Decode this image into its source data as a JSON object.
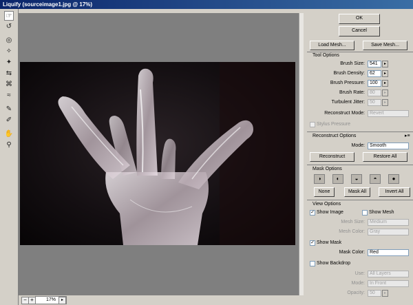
{
  "window": {
    "title": "Liquify (sourceimage1.jpg @ 17%)"
  },
  "tools": [
    {
      "icon": "forward-warp-icon",
      "glyph": "☞"
    },
    {
      "icon": "reconstruct-tool-icon",
      "glyph": "↺"
    },
    {
      "icon": "twirl-clockwise-icon",
      "glyph": "◎"
    },
    {
      "icon": "pucker-icon",
      "glyph": "✧"
    },
    {
      "icon": "bloat-icon",
      "glyph": "✦"
    },
    {
      "icon": "push-left-icon",
      "glyph": "⇆"
    },
    {
      "icon": "mirror-icon",
      "glyph": "⌘"
    },
    {
      "icon": "turbulence-icon",
      "glyph": "≈"
    },
    {
      "icon": "freeze-mask-icon",
      "glyph": "✎"
    },
    {
      "icon": "thaw-mask-icon",
      "glyph": "✐"
    },
    {
      "icon": "hand-icon",
      "glyph": "✋"
    },
    {
      "icon": "zoom-icon",
      "glyph": "⚲"
    }
  ],
  "status": {
    "zoom": "17%"
  },
  "buttons": {
    "ok": "OK",
    "cancel": "Cancel",
    "load_mesh": "Load Mesh...",
    "save_mesh": "Save Mesh..."
  },
  "tool_options": {
    "header": "Tool Options",
    "brush_size_label": "Brush Size:",
    "brush_size": "541",
    "brush_density_label": "Brush Density:",
    "brush_density": "62",
    "brush_pressure_label": "Brush Pressure:",
    "brush_pressure": "100",
    "brush_rate_label": "Brush Rate:",
    "brush_rate": "80",
    "turbulent_jitter_label": "Turbulent Jitter:",
    "turbulent_jitter": "50",
    "reconstruct_mode_label": "Reconstruct Mode:",
    "reconstruct_mode": "Revert",
    "stylus_pressure": "Stylus Pressure"
  },
  "reconstruct_options": {
    "header": "Reconstruct Options",
    "mode_label": "Mode:",
    "mode": "Smooth",
    "reconstruct": "Reconstruct",
    "restore_all": "Restore All"
  },
  "mask_options": {
    "header": "Mask Options",
    "none": "None",
    "mask_all": "Mask All",
    "invert_all": "Invert All"
  },
  "view_options": {
    "header": "View Options",
    "show_image": "Show Image",
    "show_mesh": "Show Mesh",
    "mesh_size_label": "Mesh Size:",
    "mesh_size": "Medium",
    "mesh_color_label": "Mesh Color:",
    "mesh_color": "Gray",
    "show_mask": "Show Mask",
    "mask_color_label": "Mask Color:",
    "mask_color": "Red",
    "show_backdrop": "Show Backdrop",
    "use_label": "Use:",
    "use": "All Layers",
    "mode_label": "Mode:",
    "mode": "In Front",
    "opacity_label": "Opacity:",
    "opacity": "50"
  },
  "colors": {
    "title_bar": "#0a246a",
    "dialog_bg": "#d4d0c8",
    "canvas_bg": "#7f7f7f"
  }
}
